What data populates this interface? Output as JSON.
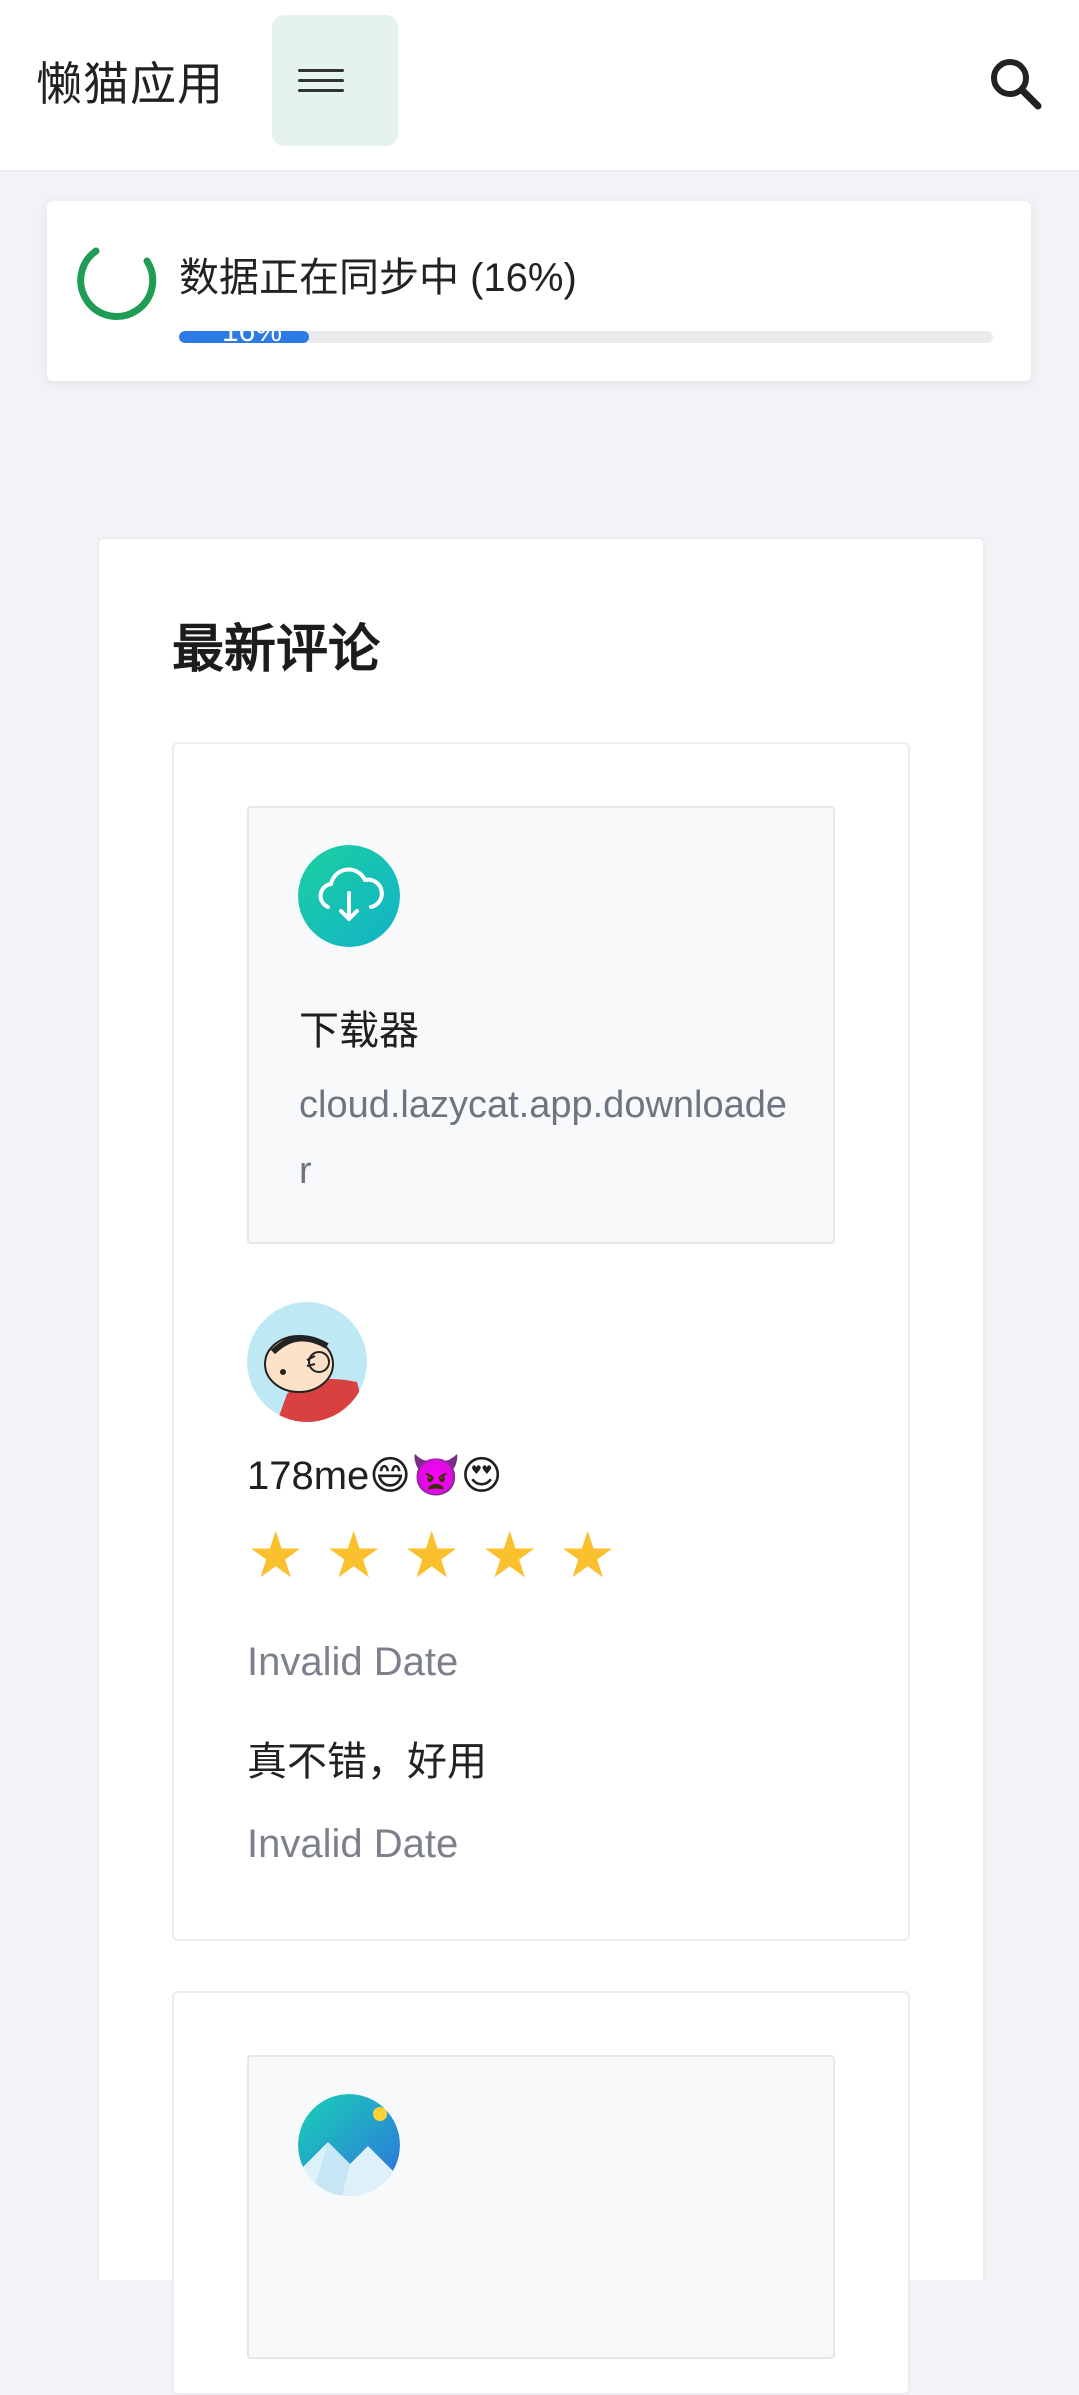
{
  "header": {
    "title": "懒猫应用",
    "menu_icon": "hamburger-menu-icon",
    "search_icon": "search-icon",
    "accent": "#e4f4ec"
  },
  "sync": {
    "text": "数据正在同步中 (16%)",
    "progress_label": "16%",
    "progress": 0.16,
    "spinner_color": "#1f9d55",
    "progress_color": "#2c7be5"
  },
  "reviews": {
    "title": "最新评论",
    "items": [
      {
        "app_icon": "cloud-download-icon",
        "app_name": "下载器",
        "app_id": "cloud.lazycat.app.downloader",
        "avatar": "cartoon-avatar",
        "user": "178me😄👿😍",
        "rating": 5,
        "date_top": "Invalid Date",
        "comment": "真不错，好用",
        "date_bottom": "Invalid Date"
      },
      {
        "app_icon": "gallery-mountain-icon"
      }
    ]
  }
}
